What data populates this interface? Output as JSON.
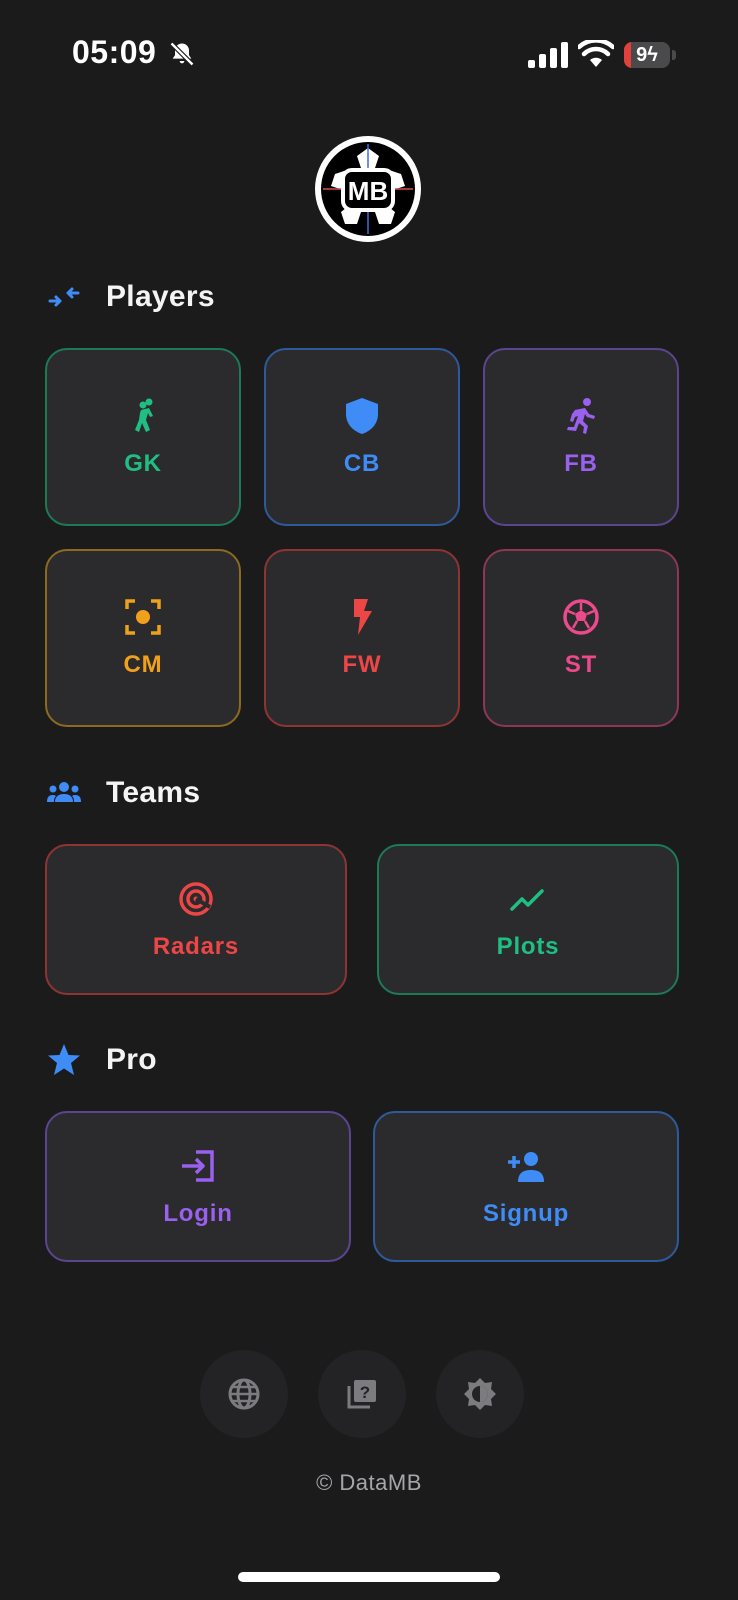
{
  "status_bar": {
    "time": "05:09",
    "battery_level": "9",
    "battery_fraction": 0.09
  },
  "colors": {
    "background": "#1b1b1c",
    "card": "#2b2b2d",
    "green": "#1fbf84",
    "blue": "#3f8cf7",
    "purple": "#9a60ee",
    "orange": "#f0a11c",
    "red": "#ec4646",
    "pink": "#ec4a8c"
  },
  "logo": {
    "text": "MB"
  },
  "players": {
    "title": "Players",
    "icon": "swap-arrows-icon",
    "items": [
      {
        "label": "GK",
        "icon": "goalkeeper-icon",
        "color": "green"
      },
      {
        "label": "CB",
        "icon": "shield-icon",
        "color": "blue"
      },
      {
        "label": "FB",
        "icon": "running-icon",
        "color": "purple"
      },
      {
        "label": "CM",
        "icon": "center-focus-icon",
        "color": "orange"
      },
      {
        "label": "FW",
        "icon": "bolt-icon",
        "color": "red"
      },
      {
        "label": "ST",
        "icon": "soccer-ball-icon",
        "color": "pink"
      }
    ]
  },
  "teams": {
    "title": "Teams",
    "icon": "group-icon",
    "items": [
      {
        "label": "Radars",
        "icon": "radar-icon",
        "color": "red"
      },
      {
        "label": "Plots",
        "icon": "trend-line-icon",
        "color": "green"
      }
    ]
  },
  "pro": {
    "title": "Pro",
    "icon": "star-icon",
    "items": [
      {
        "label": "Login",
        "icon": "login-icon",
        "color": "purple"
      },
      {
        "label": "Signup",
        "icon": "add-user-icon",
        "color": "blue"
      }
    ]
  },
  "footer": {
    "buttons": [
      {
        "icon": "globe-icon"
      },
      {
        "icon": "help-library-icon"
      },
      {
        "icon": "brightness-icon"
      }
    ],
    "copyright": "© DataMB"
  }
}
